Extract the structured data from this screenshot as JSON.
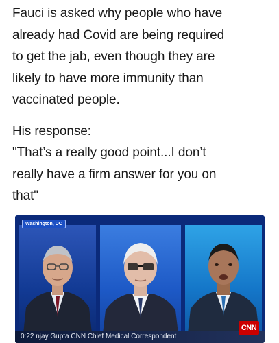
{
  "post": {
    "paragraph1_lines": [
      "Fauci is asked why people who have",
      "already had Covid are being required",
      "to get the jab, even though they are",
      "likely to have more immunity than",
      "vaccinated people."
    ],
    "paragraph2_lines": [
      "His response:",
      "\"That’s a really good point...I don’t",
      "really have a firm answer for you on",
      "that\""
    ]
  },
  "video": {
    "location_tag": "Washington, DC",
    "lower_third": "0:22 njay Gupta  CNN Chief Medical Correspondent",
    "network_logo": "CNN"
  }
}
